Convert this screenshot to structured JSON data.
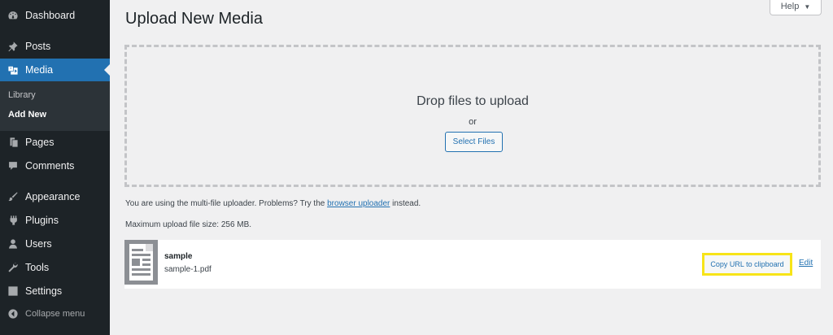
{
  "sidebar": {
    "items": [
      {
        "label": "Dashboard",
        "icon": "dashboard-icon"
      },
      {
        "label": "Posts",
        "icon": "pin-icon"
      },
      {
        "label": "Media",
        "icon": "media-icon"
      },
      {
        "label": "Pages",
        "icon": "pages-icon"
      },
      {
        "label": "Comments",
        "icon": "comment-icon"
      },
      {
        "label": "Appearance",
        "icon": "brush-icon"
      },
      {
        "label": "Plugins",
        "icon": "plugin-icon"
      },
      {
        "label": "Users",
        "icon": "user-icon"
      },
      {
        "label": "Tools",
        "icon": "wrench-icon"
      },
      {
        "label": "Settings",
        "icon": "settings-icon"
      },
      {
        "label": "Collapse menu",
        "icon": "collapse-icon"
      }
    ],
    "submenu": [
      {
        "label": "Library"
      },
      {
        "label": "Add New"
      }
    ],
    "active_color": "#2271b1",
    "bg_color": "#1d2327"
  },
  "header": {
    "title": "Upload New Media",
    "help_label": "Help"
  },
  "uploader": {
    "drop_title": "Drop files to upload",
    "or_text": "or",
    "select_button": "Select Files",
    "notice_prefix": "You are using the multi-file uploader. Problems? Try the",
    "notice_link": "browser uploader",
    "notice_suffix": "instead.",
    "max_size": "Maximum upload file size: 256 MB."
  },
  "media_item": {
    "title": "sample",
    "filename": "sample-1.pdf",
    "copy_button": "Copy URL to clipboard",
    "edit_link": "Edit",
    "highlight_color": "#f7e418"
  }
}
